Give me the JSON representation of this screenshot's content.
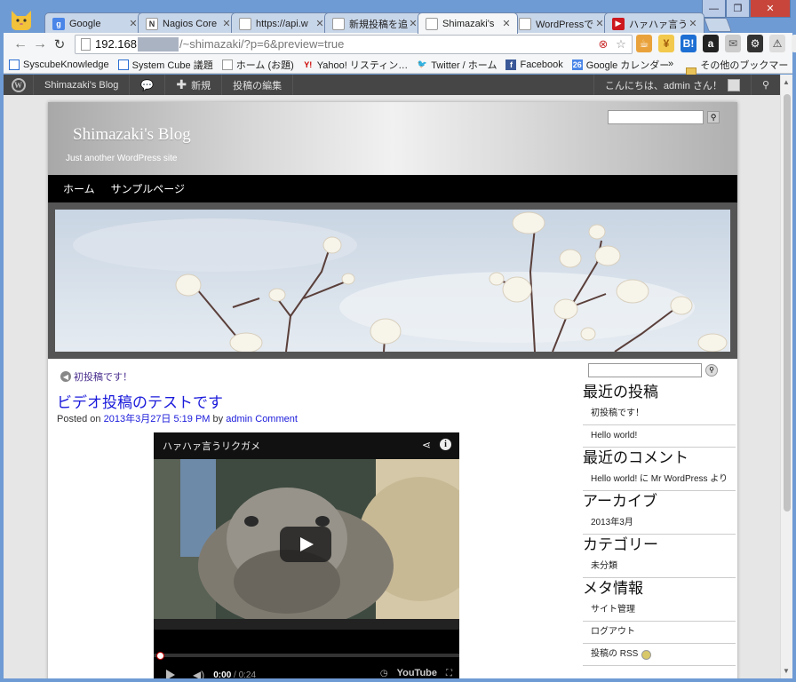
{
  "browser": {
    "tabs": [
      {
        "title": "Google",
        "icon": "google-icon",
        "fav_text": "g",
        "fav_bg": "#4a86e8",
        "active": false
      },
      {
        "title": "Nagios Core",
        "icon": "nagios-icon",
        "fav_text": "N",
        "fav_bg": "#ffffff",
        "active": false
      },
      {
        "title": "https://api.w",
        "icon": "page-icon",
        "fav_text": "",
        "fav_bg": "#ffffff",
        "active": false
      },
      {
        "title": "新規投稿を追",
        "icon": "page-icon",
        "fav_text": "",
        "fav_bg": "#ffffff",
        "active": false
      },
      {
        "title": "Shimazaki's",
        "icon": "page-icon",
        "fav_text": "",
        "fav_bg": "#ffffff",
        "active": true
      },
      {
        "title": "WordPressで",
        "icon": "page-icon",
        "fav_text": "",
        "fav_bg": "#ffffff",
        "active": false
      },
      {
        "title": "ハァハァ言う",
        "icon": "youtube-icon",
        "fav_text": "▶",
        "fav_bg": "#cc181e",
        "active": false
      }
    ],
    "url": {
      "host": "192.168",
      "path": "/~shimazaki/?p=6&preview=true"
    },
    "bookmarks": [
      {
        "label": "SyscubeKnowledge",
        "icon": "doc-icon"
      },
      {
        "label": "System Cube 議題",
        "icon": "doc-icon"
      },
      {
        "label": "ホーム (お題)",
        "icon": "page-icon"
      },
      {
        "label": "Yahoo! リスティン…",
        "icon": "yahoo-icon"
      },
      {
        "label": "Twitter / ホーム",
        "icon": "twitter-icon"
      },
      {
        "label": "Facebook",
        "icon": "facebook-icon"
      },
      {
        "label": "Google カレンダー",
        "icon": "calendar-icon"
      }
    ],
    "bookmarks_more": "»",
    "other_bookmarks": "その他のブックマーク",
    "extensions": [
      "☕",
      "¥",
      "B!",
      "a",
      "✉",
      "⚙",
      "⚠",
      "≡"
    ]
  },
  "adminbar": {
    "site": "Shimazaki's Blog",
    "new": "新規",
    "edit": "投稿の編集",
    "greeting": "こんにちは、admin さん！"
  },
  "site": {
    "title": "Shimazaki's Blog",
    "description": "Just another WordPress site",
    "menu": [
      "ホーム",
      "サンプルページ"
    ]
  },
  "post": {
    "prev_link": "初投稿です！",
    "title": "ビデオ投稿のテストです",
    "meta_prefix": "Posted on",
    "date": "2013年3月27日 5:19 PM",
    "by": "by",
    "author": "admin",
    "comment": "Comment"
  },
  "video": {
    "title": "ハァハァ言うリクガメ",
    "time_current": "0:00",
    "time_total": " / 0:24",
    "youtube": "YouTube"
  },
  "sidebar": {
    "sections": [
      {
        "heading": "最近の投稿",
        "items": [
          "初投稿です！",
          "Hello world!"
        ]
      },
      {
        "heading": "最近のコメント",
        "items": [
          "Hello world! に Mr WordPress より"
        ]
      },
      {
        "heading": "アーカイブ",
        "items": [
          "2013年3月"
        ]
      },
      {
        "heading": "カテゴリー",
        "items": [
          "未分類"
        ]
      },
      {
        "heading": "メタ情報",
        "items": [
          "サイト管理",
          "ログアウト",
          "投稿の RSS"
        ]
      }
    ]
  }
}
